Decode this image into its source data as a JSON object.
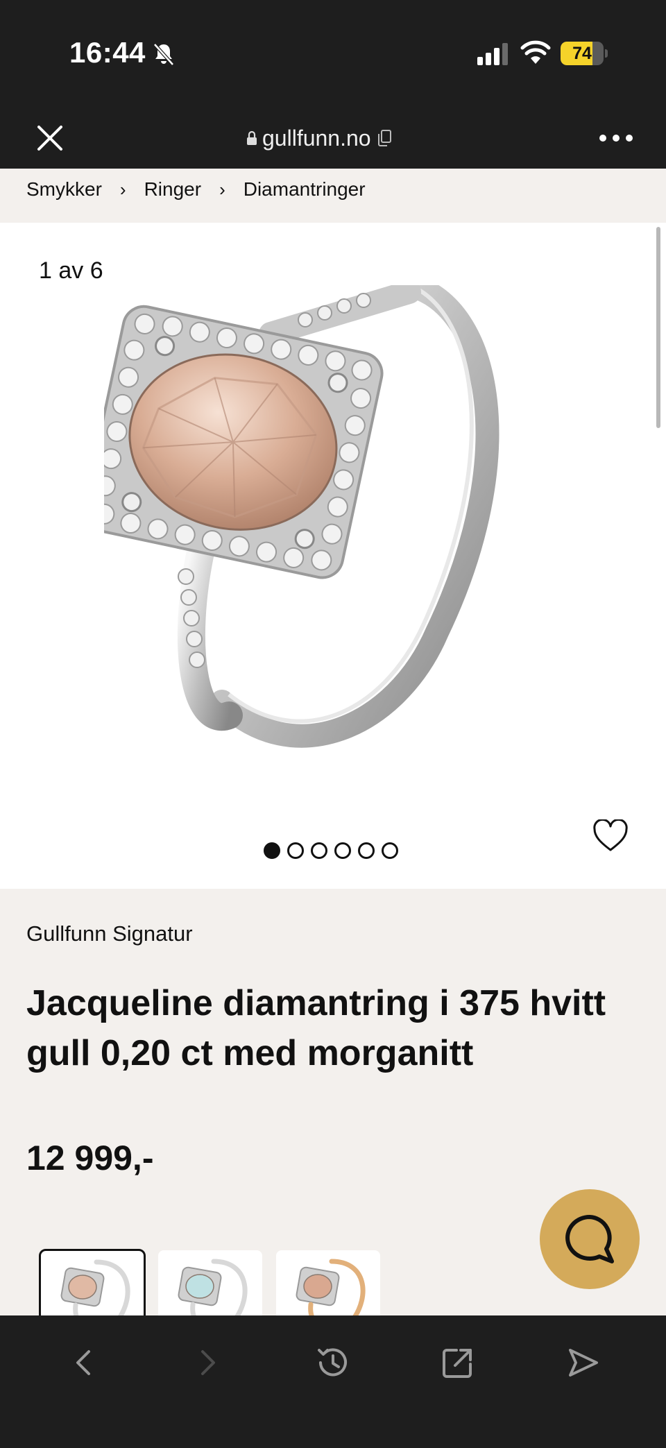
{
  "status_bar": {
    "time": "16:44",
    "battery_percent": "74",
    "battery_level": 0.74
  },
  "browser": {
    "url": "gullfunn.no"
  },
  "breadcrumb": [
    "Smykker",
    "Ringer",
    "Diamantringer"
  ],
  "gallery": {
    "counter": "1 av 6",
    "total_images": 6,
    "active_index": 0
  },
  "product": {
    "brand": "Gullfunn Signatur",
    "title": "Jacqueline diamantring i 375 hvitt gull 0,20 ct med morganitt",
    "price": "12 999,-"
  },
  "variants": [
    {
      "stone_color": "#e0b9a4",
      "metal_color": "#d8d8d8",
      "selected": true
    },
    {
      "stone_color": "#bfe1e3",
      "metal_color": "#d8d8d8",
      "selected": false
    },
    {
      "stone_color": "#d9a890",
      "metal_color": "#e2b07a",
      "selected": false
    }
  ],
  "colors": {
    "chrome_dark": "#1e1e1e",
    "page_bg": "#f3f0ed",
    "chat_accent": "#d4aa5a"
  }
}
